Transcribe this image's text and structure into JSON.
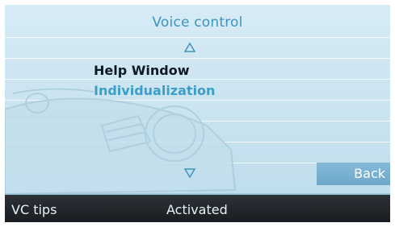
{
  "menu": {
    "title": "Voice control",
    "items": [
      {
        "label": "Help Window",
        "selected": true
      },
      {
        "label": "Individualization",
        "selected": false
      }
    ],
    "scroll_up_icon": "triangle-up-outline",
    "scroll_down_icon": "triangle-down-outline"
  },
  "back_button": {
    "label": "Back"
  },
  "bottom_bar": {
    "left_label": "VC tips",
    "status": "Activated"
  },
  "colors": {
    "title": "#3f93bf",
    "selected_item": "#0e1a22",
    "unselected_item": "#3a9ec8",
    "background": "#cbe4f0",
    "bottom_bar": "#1c2126",
    "back_button": "#7ab2d2"
  }
}
